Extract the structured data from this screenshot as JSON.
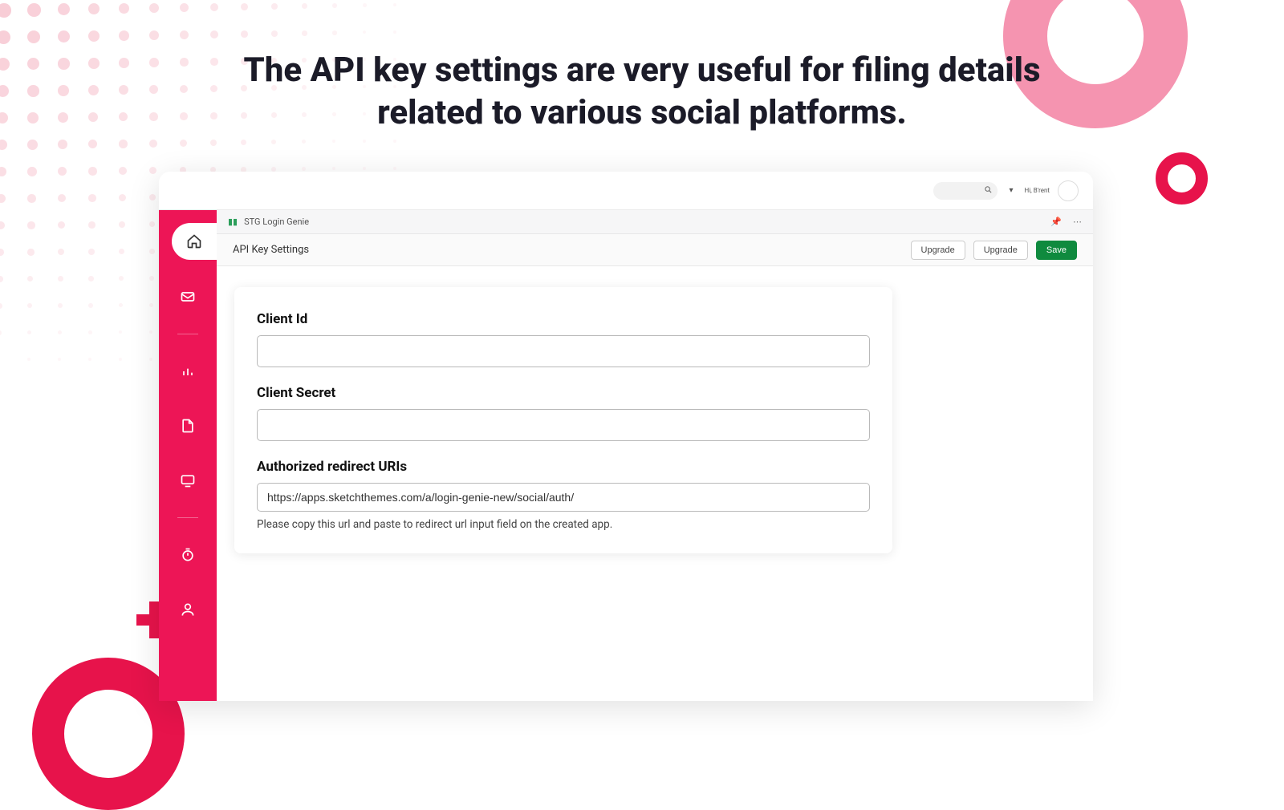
{
  "hero": {
    "title": "The API key settings are very useful for filing details related to various social platforms."
  },
  "topbar": {
    "greeting": "Hi, B'rent"
  },
  "breadcrumb": {
    "app_name": "STG Login Genie"
  },
  "titlebar": {
    "title": "API Key Settings",
    "upgrade1": "Upgrade",
    "upgrade2": "Upgrade",
    "save": "Save"
  },
  "form": {
    "client_id_label": "Client Id",
    "client_id_value": "",
    "client_secret_label": "Client Secret",
    "client_secret_value": "",
    "redirect_label": "Authorized redirect URIs",
    "redirect_value": "https://apps.sketchthemes.com/a/login-genie-new/social/auth/",
    "redirect_help": "Please copy this url and paste to redirect url input field on the created app."
  },
  "colors": {
    "brand_pink": "#ed1556",
    "accent_red": "#e7134b",
    "save_green": "#0f8a3e"
  }
}
